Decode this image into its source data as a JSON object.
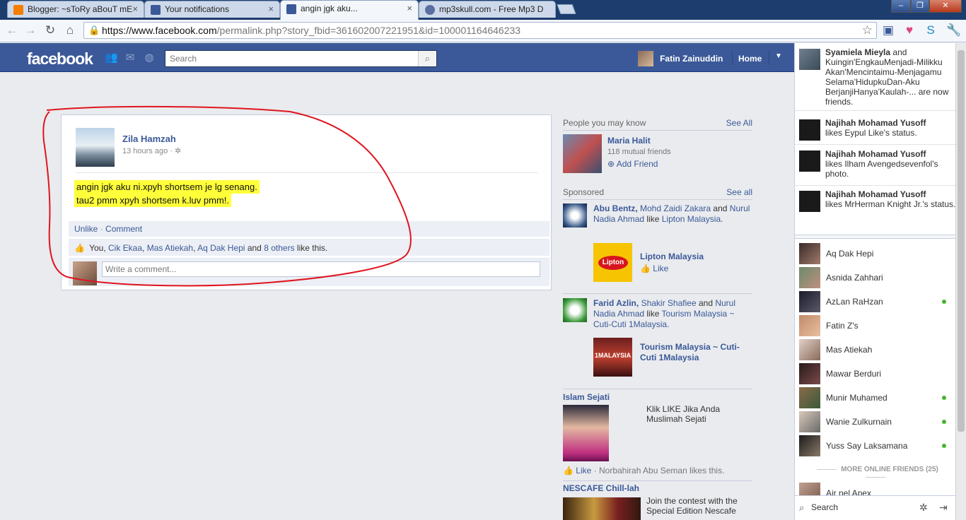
{
  "browser": {
    "tabs": [
      {
        "title": "Blogger: ~sToRy aBouT mE",
        "icon": "blogger-icon",
        "color": "#f57d00"
      },
      {
        "title": "Your notifications",
        "icon": "facebook-icon",
        "color": "#3b5998"
      },
      {
        "title": "angin jgk aku...",
        "icon": "facebook-icon",
        "color": "#3b5998"
      },
      {
        "title": "mp3skull.com - Free Mp3 D",
        "icon": "globe-icon",
        "color": "#5a6ea0"
      }
    ],
    "close_glyph": "×",
    "url_host": "https://www.facebook.com",
    "url_path": "/permalink.php?story_fbid=361602007221951&id=100001164646233"
  },
  "facebook": {
    "logo": "facebook",
    "search_placeholder": "Search",
    "user_name": "Fatin Zainuddin",
    "home_label": "Home"
  },
  "story": {
    "author": "Zila Hamzah",
    "time": "13 hours ago",
    "message_line1": "angin jgk aku ni.xpyh shortsem je lg senang.",
    "message_line2": "tau2 pmm xpyh shortsem k.luv pmm!.",
    "unlike_label": "Unlike",
    "comment_label": "Comment",
    "likes_you": "You,",
    "likes_friend1": "Cik Ekaa",
    "likes_friend2": "Mas Atiekah",
    "likes_friend3": "Aq Dak Hepi",
    "likes_and": "and",
    "likes_others": "8 others",
    "likes_suffix": "like this.",
    "comment_placeholder": "Write a comment..."
  },
  "right_column": {
    "pymk_title": "People you may know",
    "pymk_see_all": "See All",
    "pymk_name": "Maria Halit",
    "pymk_mutual": "118 mutual friends",
    "pymk_add": "Add Friend",
    "sponsored_title": "Sponsored",
    "sponsored_see_all": "See all",
    "ad1_line_a": "Abu Bentz,",
    "ad1_line_b": "Mohd Zaidi Zakara",
    "ad1_line_c": "and",
    "ad1_line_d": "Nurul Nadia Ahmad",
    "ad1_line_e": "like",
    "ad1_line_f": "Lipton Malaysia.",
    "ad1_title": "Lipton Malaysia",
    "ad1_like": "Like",
    "ad1_brand": "Lipton",
    "ad2_line_a": "Farid Azlin,",
    "ad2_line_b": "Shakir Shafiee",
    "ad2_line_c": "and",
    "ad2_line_d": "Nurul Nadia Ahmad",
    "ad2_line_e": "like",
    "ad2_line_f": "Tourism Malaysia ~ Cuti-Cuti 1Malaysia.",
    "ad2_title": "Tourism Malaysia ~ Cuti-Cuti 1Malaysia",
    "ad2_brand": "1MALAYSIA",
    "ad3_title": "Islam Sejati",
    "ad3_text": "Klik LIKE Jika Anda Muslimah Sejati",
    "ad3_like": "Like",
    "ad3_likes": "Norbahirah Abu Seman likes this.",
    "ad4_title": "NESCAFE Chill-lah",
    "ad4_text": "Join the contest with the Special Edition Nescafe"
  },
  "ticker": [
    {
      "name": "Syamiela Mieyla",
      "text": "and Kuingin'EngkauMenjadi-Milikku Akan'Mencintaimu-Menjagamu Selama'HidupkuDan-Aku BerjanjiHanya'Kaulah-... are now friends."
    },
    {
      "name": "Najihah Mohamad Yusoff",
      "text": "likes Eypul Like's status."
    },
    {
      "name": "Najihah Mohamad Yusoff",
      "text": "likes Ilham Avengedsevenfol's photo."
    },
    {
      "name": "Najihah Mohamad Yusoff",
      "text": "likes MrHerman Knight Jr.'s status."
    }
  ],
  "chat": {
    "friends": [
      {
        "name": "Aq Dak Hepi",
        "online": false
      },
      {
        "name": "Asnida Zahhari",
        "online": false
      },
      {
        "name": "AzLan RaHzan",
        "online": true
      },
      {
        "name": "Fatin Z's",
        "online": false
      },
      {
        "name": "Mas Atiekah",
        "online": false
      },
      {
        "name": "Mawar Berduri",
        "online": false
      },
      {
        "name": "Munir Muhamed",
        "online": true
      },
      {
        "name": "Wanie Zulkurnain",
        "online": true
      },
      {
        "name": "Yuss Say Laksamana",
        "online": true
      }
    ],
    "more_online": "MORE ONLINE FRIENDS (25)",
    "partial_friend": "Air nel Apex",
    "search_label": "Search"
  },
  "colors": {
    "facebook_blue": "#3b5998",
    "highlight": "#ffff3a",
    "annotation": "#e0141e",
    "online": "#42b72a"
  }
}
